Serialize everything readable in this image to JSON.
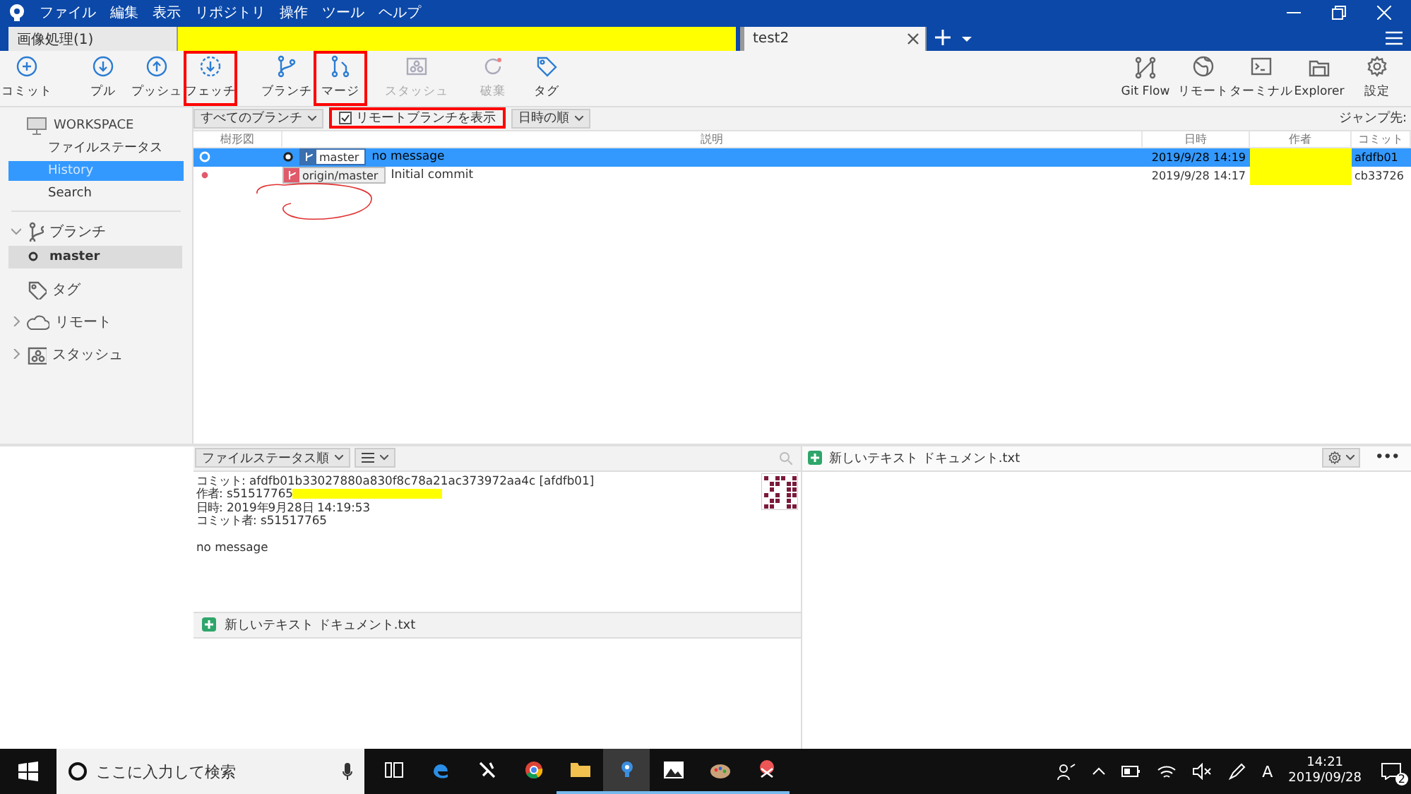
{
  "menu": [
    "ファイル",
    "編集",
    "表示",
    "リポジトリ",
    "操作",
    "ツール",
    "ヘルプ"
  ],
  "tabs": [
    {
      "label": "画像処理(1)",
      "selected": false,
      "redacted": true
    },
    {
      "label": "test2",
      "selected": true,
      "closable": true
    }
  ],
  "toolbar": {
    "left": [
      {
        "label": "コミット",
        "kind": "commit",
        "disabled": false,
        "marked": false
      },
      {
        "label": "プル",
        "kind": "pull",
        "disabled": false,
        "marked": false
      },
      {
        "label": "プッシュ",
        "kind": "push",
        "disabled": false,
        "marked": false
      },
      {
        "label": "フェッチ",
        "kind": "fetch",
        "disabled": false,
        "marked": true
      },
      {
        "label": "ブランチ",
        "kind": "branch",
        "disabled": false,
        "marked": false
      },
      {
        "label": "マージ",
        "kind": "merge",
        "disabled": false,
        "marked": true
      },
      {
        "label": "スタッシュ",
        "kind": "stash",
        "disabled": true,
        "marked": false
      },
      {
        "label": "破棄",
        "kind": "discard",
        "disabled": true,
        "marked": false
      },
      {
        "label": "タグ",
        "kind": "tag",
        "disabled": false,
        "marked": false
      }
    ],
    "right": [
      {
        "label": "Git Flow",
        "kind": "gitflow",
        "disabled": false,
        "marked": false
      },
      {
        "label": "リモート",
        "kind": "remote",
        "disabled": false,
        "marked": false
      },
      {
        "label": "ターミナル",
        "kind": "terminal",
        "disabled": false,
        "marked": false
      },
      {
        "label": "Explorer",
        "kind": "explorer",
        "disabled": false,
        "marked": false
      },
      {
        "label": "設定",
        "kind": "settings",
        "disabled": false,
        "marked": false
      }
    ]
  },
  "sidebar": {
    "workspace": "WORKSPACE",
    "workspace_items": [
      {
        "label": "ファイルステータス",
        "selected": false
      },
      {
        "label": "History",
        "selected": true
      },
      {
        "label": "Search",
        "selected": false
      }
    ],
    "groups": [
      {
        "label": "ブランチ",
        "kind": "branch",
        "expanded": true,
        "children": [
          {
            "label": "master",
            "selected": true
          }
        ]
      },
      {
        "label": "タグ",
        "kind": "tag"
      },
      {
        "label": "リモート",
        "kind": "remote",
        "expanded": false
      },
      {
        "label": "スタッシュ",
        "kind": "stash",
        "expanded": false
      }
    ]
  },
  "filter_bar": {
    "branches": "すべてのブランチ",
    "show_remote": {
      "label": "リモートブランチを表示",
      "checked": true,
      "marked": true
    },
    "order": "日時の順",
    "jump": "ジャンプ先:"
  },
  "columns": [
    "樹形図",
    "説明",
    "日時",
    "作者",
    "コミット"
  ],
  "commits": [
    {
      "selected": true,
      "branch": {
        "label": "master",
        "kind": "local",
        "current": true,
        "circled": false
      },
      "message": "no message",
      "date": "2019/9/28  14:19",
      "author_redacted": true,
      "commit": "afdfb01"
    },
    {
      "selected": false,
      "branch": {
        "label": "origin/master",
        "kind": "remote",
        "current": false,
        "circled": true
      },
      "message": "Initial commit",
      "date": "2019/9/28  14:17",
      "author_redacted": true,
      "commit": "cb33726"
    }
  ],
  "detail": {
    "sort": "ファイルステータス順",
    "fields": [
      {
        "label": "コミット:",
        "value": "afdfb01b33027880a830f8c78a21ac373972aa4c [afdfb01]",
        "redacted": false
      },
      {
        "label": "作者:",
        "value": "s51517765",
        "redacted": true
      },
      {
        "label": "日時:",
        "value": "2019年9月28日 14:19:53",
        "redacted": false
      },
      {
        "label": "コミット者:",
        "value": "s51517765",
        "redacted": false
      }
    ],
    "message": "no message",
    "files": [
      {
        "name": "新しいテキスト ドキュメント.txt",
        "kind": "added"
      }
    ]
  },
  "diff": {
    "file": "新しいテキスト ドキュメント.txt",
    "kind": "added",
    "more": "•••"
  },
  "taskbar": {
    "search_placeholder": "ここに入力して検索",
    "apps": [
      {
        "kind": "taskview",
        "selected": false,
        "running": false
      },
      {
        "kind": "edge",
        "selected": false,
        "running": false
      },
      {
        "kind": "tool",
        "selected": false,
        "running": false
      },
      {
        "kind": "chrome",
        "selected": false,
        "running": false
      },
      {
        "kind": "folder",
        "selected": false,
        "running": true
      },
      {
        "kind": "sourcetree",
        "selected": true,
        "running": true
      },
      {
        "kind": "photos",
        "selected": false,
        "running": true
      },
      {
        "kind": "paint",
        "selected": false,
        "running": true
      },
      {
        "kind": "snip",
        "selected": false,
        "running": true
      }
    ],
    "ime": "A",
    "time": "14:21",
    "date": "2019/09/28",
    "notifications": "2"
  }
}
